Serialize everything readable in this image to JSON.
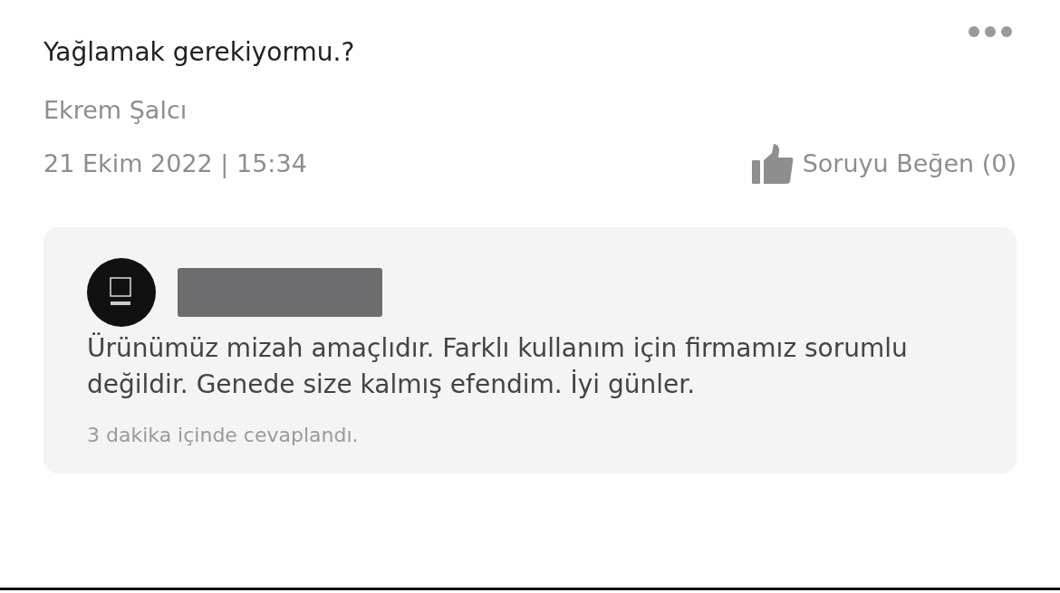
{
  "question": {
    "title": "Yağlamak gerekiyormu.?",
    "author": "Ekrem Şalcı",
    "date": "21 Ekim 2022 | 15:34",
    "like_label": "Soruyu Beğen (0)"
  },
  "answer": {
    "seller_name_redacted": true,
    "text": "Ürünümüz mizah amaçlıdır. Farklı kullanım için firmamız sorumlu değildir. Genede size kalmış efendim. İyi günler.",
    "response_time": "3 dakika içinde cevaplandı."
  }
}
